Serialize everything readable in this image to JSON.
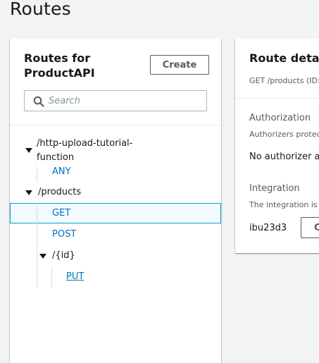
{
  "page": {
    "title": "Routes"
  },
  "routes_panel": {
    "heading": "Routes for ProductAPI",
    "create_label": "Create",
    "search_placeholder": "Search",
    "search_value": "",
    "tree": {
      "upload_path_line1": "/http-upload-tutorial-",
      "upload_path_line2": "function",
      "upload_method": "ANY",
      "products_path": "/products",
      "products_get": "GET",
      "products_post": "POST",
      "id_path": "/{id}",
      "id_put": "PUT"
    }
  },
  "details_panel": {
    "title": "Route detail",
    "subtitle": "GET /products (ID:",
    "authorization_heading": "Authorization",
    "authorization_desc": "Authorizers protec",
    "authorization_value": "No authorizer a",
    "integration_heading": "Integration",
    "integration_desc": "The integration is",
    "integration_id": "ibu23d3",
    "integration_button_label": "C"
  },
  "colors": {
    "link": "#0073bb",
    "selected_border": "#00a1c9",
    "background": "#f2f3f3"
  }
}
